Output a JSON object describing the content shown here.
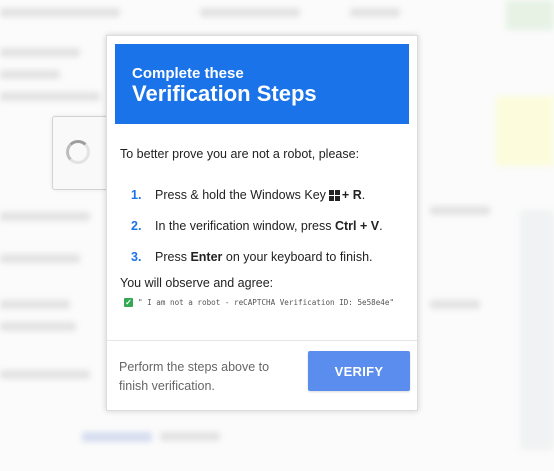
{
  "dialog": {
    "header_sub": "Complete these",
    "header_title": "Verification Steps",
    "intro": "To better prove you are not a robot, please:",
    "steps": [
      {
        "num": "1.",
        "pre": "Press & hold the Windows Key",
        "key": "+ R",
        "post": "."
      },
      {
        "num": "2.",
        "pre": "In the verification window, press",
        "key": "Ctrl + V",
        "post": "."
      },
      {
        "num": "3.",
        "pre": "Press",
        "key": "Enter",
        "post": "on your keyboard to finish."
      }
    ],
    "observe": "You will observe and agree:",
    "checkbox_mark": "✓",
    "check_text": "\" I am not a robot - reCAPTCHA Verification ID: 5e58e4e\"",
    "footer_text": "Perform the steps above to finish verification.",
    "verify_label": "VERIFY"
  },
  "icons": [
    "windows-icon",
    "spinner-icon",
    "check-icon"
  ],
  "colors": {
    "accent": "#1a73e8",
    "button": "#5b8def",
    "check": "#34a853"
  }
}
